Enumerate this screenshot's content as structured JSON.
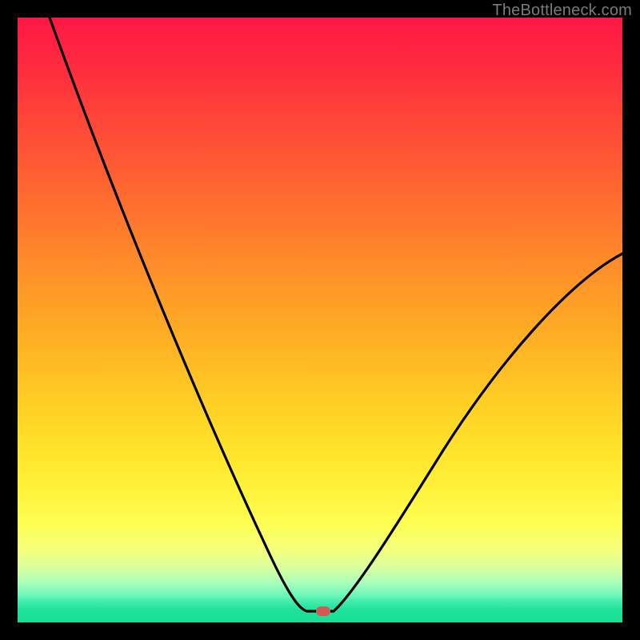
{
  "watermark": "TheBottleneck.com",
  "dot": {
    "x_frac": 0.505,
    "y_frac": 0.981
  },
  "chart_data": {
    "type": "line",
    "title": "",
    "xlabel": "",
    "ylabel": "",
    "xlim": [
      0,
      100
    ],
    "ylim": [
      0,
      100
    ],
    "series": [
      {
        "name": "bottleneck-curve",
        "x": [
          0,
          5,
          10,
          15,
          20,
          25,
          30,
          35,
          40,
          44,
          46,
          48,
          50,
          52,
          55,
          60,
          65,
          70,
          75,
          80,
          85,
          90,
          95,
          100
        ],
        "y": [
          100,
          90,
          80,
          71,
          62,
          53,
          44,
          35,
          25,
          13,
          7,
          3,
          2,
          2,
          3,
          8,
          15,
          22,
          30,
          37,
          44,
          50,
          56,
          61
        ]
      }
    ],
    "marker": {
      "x": 50.5,
      "y": 2
    },
    "background_gradient": {
      "direction": "vertical",
      "stops": [
        {
          "pos": 0.0,
          "color": "#ff1744"
        },
        {
          "pos": 0.5,
          "color": "#ffa126"
        },
        {
          "pos": 0.8,
          "color": "#fff23a"
        },
        {
          "pos": 0.95,
          "color": "#6cf7bc"
        },
        {
          "pos": 1.0,
          "color": "#19df96"
        }
      ]
    }
  }
}
